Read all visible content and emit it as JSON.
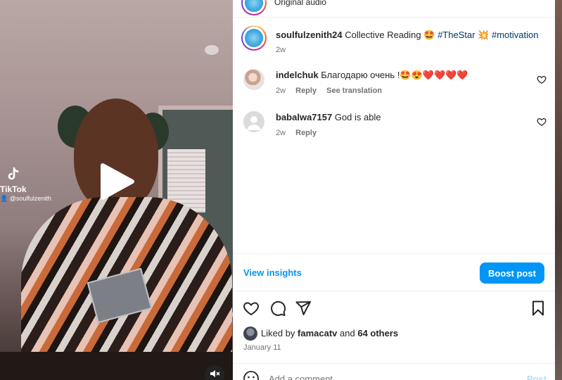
{
  "video": {
    "watermark_brand": "TikTok",
    "watermark_user": "@soulfulzenith"
  },
  "header": {
    "audio_label": "Original audio"
  },
  "caption": {
    "username": "soulfulzenith24",
    "text_1": " Collective Reading ",
    "emoji_1": "🤩",
    "hashtag_1": "#TheStar",
    "emoji_2": "💥",
    "hashtag_2": "#motivation",
    "time": "2w"
  },
  "comments": [
    {
      "username": "indelchuk",
      "text": " Благодарю очень !🤩😍❤️❤️❤️❤️",
      "time": "2w",
      "reply_label": "Reply",
      "translate_label": "See translation"
    },
    {
      "username": "babalwa7157",
      "text": " God is able",
      "time": "2w",
      "reply_label": "Reply"
    }
  ],
  "insights": {
    "view_label": "View insights",
    "boost_label": "Boost post"
  },
  "likes": {
    "prefix": "Liked by ",
    "user": "famacatv",
    "and": " and ",
    "others": "64 others"
  },
  "date": "January 11",
  "comment_box": {
    "placeholder": "Add a comment…",
    "post_label": "Post"
  },
  "colors": {
    "accent": "#0095f6",
    "hashtag": "#00376b",
    "muted": "#737373"
  }
}
